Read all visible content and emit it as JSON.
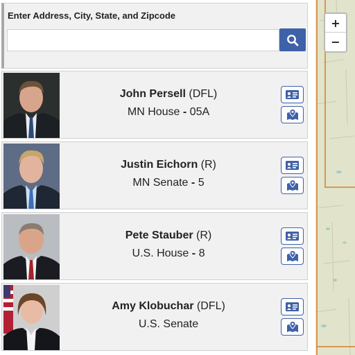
{
  "search": {
    "label": "Enter Address, City, State, and Zipcode",
    "value": "",
    "placeholder": "",
    "button_icon": "search-icon"
  },
  "reps": [
    {
      "name": "John Persell",
      "party": "(DFL)",
      "chamber": "MN House",
      "district": "05A"
    },
    {
      "name": "Justin Eichorn",
      "party": "(R)",
      "chamber": "MN Senate",
      "district": "5"
    },
    {
      "name": "Pete Stauber",
      "party": "(R)",
      "chamber": "U.S. House",
      "district": "8"
    },
    {
      "name": "Amy Klobuchar",
      "party": "(DFL)",
      "chamber": "U.S. Senate",
      "district": ""
    }
  ],
  "rep_actions": {
    "contact_icon": "contact-card-icon",
    "map_icon": "map-pin-icon"
  },
  "map": {
    "zoom_in": "+",
    "zoom_out": "−"
  },
  "colors": {
    "accent": "#3f61a8",
    "card_bg": "#f1f1f1",
    "map_bg": "#e1e4ca",
    "boundary": "#d97c2a"
  }
}
